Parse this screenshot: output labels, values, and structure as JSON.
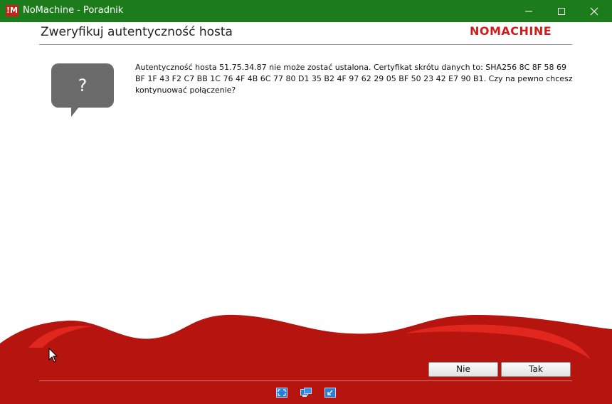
{
  "window": {
    "title": "NoMachine - Poradnik",
    "icon_text": "!M"
  },
  "header": {
    "title": "Zweryfikuj autentyczność hosta",
    "logo": "NOMACHINE"
  },
  "dialog": {
    "bubble_symbol": "?",
    "message": "Autentyczność hosta 51.75.34.87 nie może zostać ustalona. Certyfikat skrótu danych to: SHA256 8C 8F 58 69 BF 1F 43 F2 C7 BB 1C 76 4F 4B 6C 77 80 D1 35 B2 4F 97 62 29 05 BF 50 23 42 E7 90 B1. Czy na pewno chcesz kontynuować połączenie?"
  },
  "buttons": {
    "no": "Nie",
    "yes": "Tak"
  },
  "colors": {
    "titlebar": "#1c7c1c",
    "brand_red": "#d21a1a",
    "wave_red": "#b5140f"
  }
}
